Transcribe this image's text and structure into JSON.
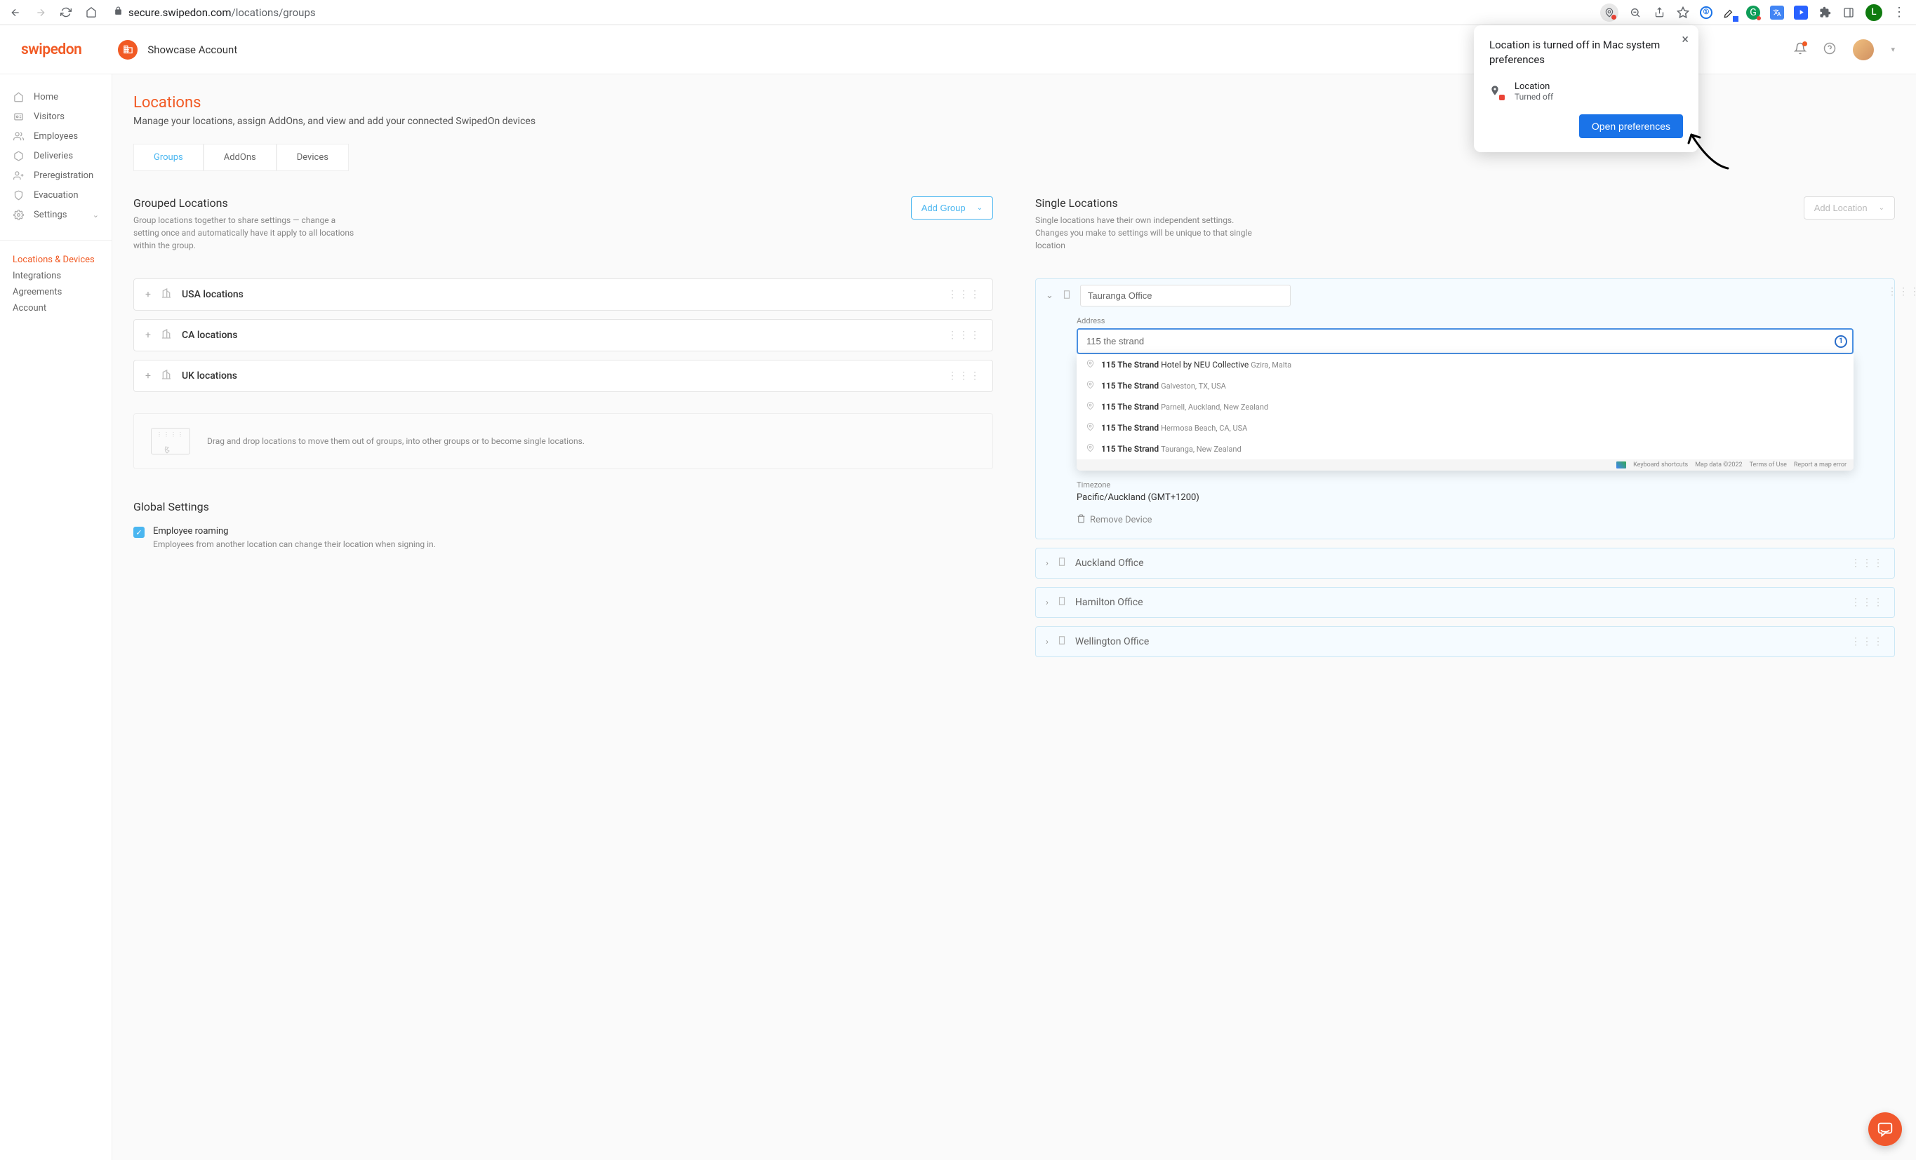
{
  "browser": {
    "url_host": "secure.swipedon.com",
    "url_path": "/locations/groups",
    "profile_letter": "L"
  },
  "popup": {
    "title": "Location is turned off in Mac system preferences",
    "row_title": "Location",
    "row_sub": "Turned off",
    "button_label": "Open preferences"
  },
  "app": {
    "logo": "swipedon",
    "account": "Showcase Account"
  },
  "sidebar": {
    "items": [
      {
        "label": "Home"
      },
      {
        "label": "Visitors"
      },
      {
        "label": "Employees"
      },
      {
        "label": "Deliveries"
      },
      {
        "label": "Preregistration"
      },
      {
        "label": "Evacuation"
      },
      {
        "label": "Settings"
      }
    ],
    "secondary": [
      {
        "label": "Locations & Devices"
      },
      {
        "label": "Integrations"
      },
      {
        "label": "Agreements"
      },
      {
        "label": "Account"
      }
    ]
  },
  "page": {
    "title": "Locations",
    "subtitle": "Manage your locations, assign AddOns, and view and add your connected SwipedOn devices"
  },
  "tabs": [
    {
      "label": "Groups"
    },
    {
      "label": "AddOns"
    },
    {
      "label": "Devices"
    }
  ],
  "grouped": {
    "title": "Grouped Locations",
    "desc": "Group locations together to share settings — change a setting once and automatically have it apply to all locations within the group.",
    "add_button": "Add Group",
    "groups": [
      {
        "name": "USA locations"
      },
      {
        "name": "CA locations"
      },
      {
        "name": "UK locations"
      }
    ],
    "hint": "Drag and drop locations to move them out of groups, into other groups or to become single locations."
  },
  "global": {
    "title": "Global Settings",
    "roaming_label": "Employee roaming",
    "roaming_desc": "Employees from another location can change their location when signing in."
  },
  "single": {
    "title": "Single Locations",
    "desc": "Single locations have their own independent settings. Changes you make to settings will be unique to that single location",
    "add_button": "Add Location",
    "expanded": {
      "name": "Tauranga Office",
      "address_label": "Address",
      "address_value": "115 the strand",
      "suggestions": [
        {
          "main": "115 The Strand",
          "secondary": "Hotel by NEU Collective",
          "sub": "Gzira, Malta"
        },
        {
          "main": "115 The Strand",
          "secondary": "",
          "sub": "Galveston, TX, USA"
        },
        {
          "main": "115 The Strand",
          "secondary": "",
          "sub": "Parnell, Auckland, New Zealand"
        },
        {
          "main": "115 The Strand",
          "secondary": "",
          "sub": "Hermosa Beach, CA, USA"
        },
        {
          "main": "115 The Strand",
          "secondary": "",
          "sub": "Tauranga, New Zealand"
        }
      ],
      "map_footer": [
        "Keyboard shortcuts",
        "Map data ©2022",
        "Terms of Use",
        "Report a map error"
      ],
      "timezone_label": "Timezone",
      "timezone_value": "Pacific/Auckland (GMT+1200)",
      "remove_label": "Remove Device"
    },
    "collapsed": [
      {
        "name": "Auckland Office"
      },
      {
        "name": "Hamilton Office"
      },
      {
        "name": "Wellington Office"
      }
    ]
  }
}
